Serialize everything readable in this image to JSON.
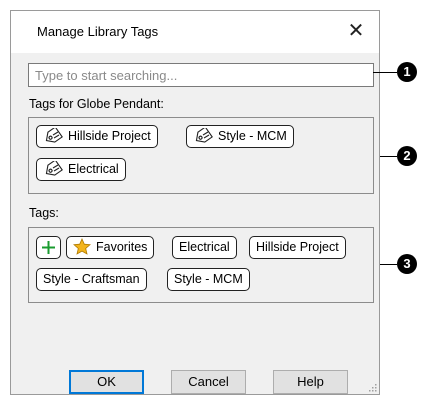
{
  "dialog": {
    "title": "Manage Library Tags",
    "close_glyph": "✕",
    "search": {
      "placeholder": "Type to start searching...",
      "value": ""
    },
    "assigned_section": {
      "label": "Tags for Globe Pendant:",
      "tags": [
        {
          "label": "Hillside Project",
          "icon": "tag-icon"
        },
        {
          "label": "Style - MCM",
          "icon": "tag-icon"
        },
        {
          "label": "Electrical",
          "icon": "tag-icon"
        }
      ]
    },
    "tags_section": {
      "label": "Tags:",
      "add_glyph": "+",
      "tags": [
        {
          "label": "Favorites",
          "icon": "star-icon"
        },
        {
          "label": "Electrical"
        },
        {
          "label": "Hillside Project"
        },
        {
          "label": "Style - Craftsman"
        },
        {
          "label": "Style - MCM"
        }
      ]
    },
    "buttons": {
      "ok": "OK",
      "cancel": "Cancel",
      "help": "Help"
    }
  },
  "callouts": [
    "1",
    "2",
    "3"
  ],
  "colors": {
    "accent": "#0078d7",
    "add_green": "#1a9b2f",
    "star": "#f3b41b"
  }
}
